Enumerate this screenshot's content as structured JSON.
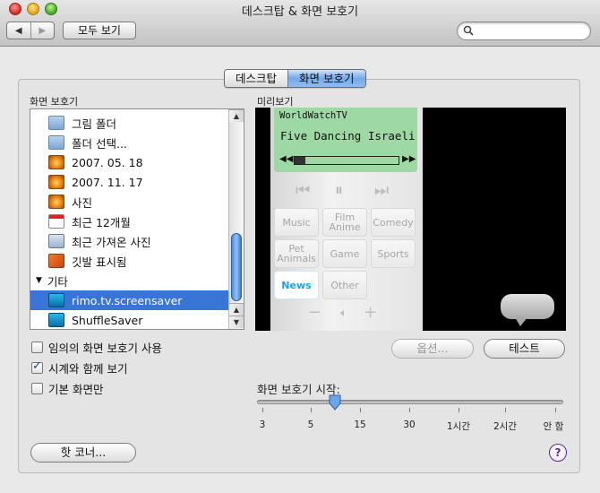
{
  "window": {
    "title": "데스크탑 & 화면 보호기"
  },
  "toolbar": {
    "back": "◀",
    "forward": "▶",
    "show_all": "모두 보기",
    "search_value": ""
  },
  "tabs": [
    {
      "label": "데스크탑",
      "active": false
    },
    {
      "label": "화면 보호기",
      "active": true
    }
  ],
  "screensaver_list": {
    "heading": "화면 보호기",
    "items": [
      {
        "label": "그림 폴더",
        "icon": "folder-icon"
      },
      {
        "label": "폴더 선택...",
        "icon": "folder-icon"
      },
      {
        "label": "2007. 05. 18",
        "icon": "photo-event-icon"
      },
      {
        "label": "2007. 11. 17",
        "icon": "photo-event-icon"
      },
      {
        "label": "사진",
        "icon": "photo-event-icon"
      },
      {
        "label": "최근 12개월",
        "icon": "calendar-icon"
      },
      {
        "label": "최근 가져온 사진",
        "icon": "import-icon"
      },
      {
        "label": "깃발 표시됨",
        "icon": "flag-icon"
      },
      {
        "label": "기타",
        "group": true
      },
      {
        "label": "rimo.tv.screensaver",
        "icon": "rimo-icon",
        "selected": true
      },
      {
        "label": "ShuffleSaver",
        "icon": "rimo-icon"
      }
    ]
  },
  "preview": {
    "heading": "미리보기",
    "channel": "WorldWatchTV",
    "show_title": "Five Dancing Israeli",
    "progress": 0.1,
    "categories": [
      "Music",
      "Film\nAnime",
      "Comedy",
      "Pet\nAnimals",
      "Game",
      "Sports",
      "News",
      "Other"
    ],
    "active_category": "News"
  },
  "buttons": {
    "options": "옵션...",
    "test": "테스트",
    "hot_corners": "핫 코너..."
  },
  "checkboxes": [
    {
      "label": "임의의 화면 보호기 사용",
      "checked": false
    },
    {
      "label": "시계와 함께 보기",
      "checked": true
    },
    {
      "label": "기본 화면만",
      "checked": false
    }
  ],
  "start_slider": {
    "label": "화면 보호기 시작:",
    "tick_labels": [
      "3",
      "5",
      "15",
      "30",
      "1시간",
      "2시간",
      "안 함"
    ],
    "selected_value": "10분"
  },
  "help_label": "?",
  "colors": {
    "selection": "#3875d7",
    "preview_green": "#9ed8a5",
    "active_tab": "#76a9e6"
  }
}
